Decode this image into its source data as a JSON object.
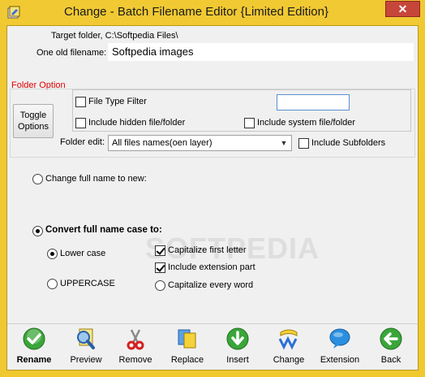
{
  "window": {
    "title": "Change - Batch Filename Editor {Limited Edition}",
    "close_label": "✕"
  },
  "info": {
    "target_folder": "Target folder,  C:\\Softpedia Files\\",
    "old_filename_label": "One old filename:",
    "old_filename_value": "Softpedia images"
  },
  "folder_option": {
    "heading": "Folder Option",
    "toggle_label_line1": "Toggle",
    "toggle_label_line2": "Options",
    "file_type_filter": "File Type Filter",
    "file_type_filter_checked": false,
    "filter_value": "",
    "include_hidden": "Include hidden file/folder",
    "include_hidden_checked": false,
    "include_system": "Include system file/folder",
    "include_system_checked": false,
    "folder_edit_label": "Folder edit:",
    "folder_edit_value": "All files names(oen layer)",
    "include_subfolders": "Include Subfolders",
    "include_subfolders_checked": false
  },
  "mode": {
    "change_full_name": "Change full name to new:",
    "change_full_name_selected": false,
    "convert_case": "Convert full name case to:",
    "convert_case_selected": true
  },
  "case_options": {
    "lower_case": "Lower case",
    "lower_case_selected": true,
    "uppercase": "UPPERCASE",
    "uppercase_selected": false,
    "capitalize_first": "Capitalize first letter",
    "capitalize_first_checked": true,
    "include_extension": "Include extension part",
    "include_extension_checked": true,
    "capitalize_every_word": "Capitalize every word",
    "capitalize_every_word_selected": false
  },
  "watermark": "SOFTPEDIA",
  "toolbar": [
    {
      "label": "Rename",
      "icon": "rename-check-icon",
      "bold": true
    },
    {
      "label": "Preview",
      "icon": "preview-magnifier-icon"
    },
    {
      "label": "Remove",
      "icon": "remove-scissors-icon"
    },
    {
      "label": "Replace",
      "icon": "replace-papers-icon"
    },
    {
      "label": "Insert",
      "icon": "insert-arrow-icon"
    },
    {
      "label": "Change",
      "icon": "change-text-icon"
    },
    {
      "label": "Extension",
      "icon": "extension-bubble-icon"
    },
    {
      "label": "Back",
      "icon": "back-arrow-icon"
    }
  ],
  "colors": {
    "title_bar": "#f1c933",
    "close_button": "#c7463a",
    "folder_option_heading": "#e00000",
    "rename_green": "#3aa63a",
    "back_green": "#3aa63a"
  }
}
